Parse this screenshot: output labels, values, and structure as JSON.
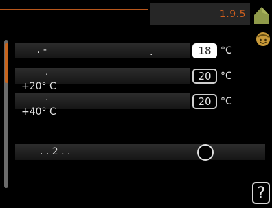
{
  "header": {
    "menu_number": "1.9.5"
  },
  "rows": [
    {
      "label_dots": ".   -",
      "label_dot_2": ".",
      "value": "18",
      "unit": "°C",
      "selected": true
    },
    {
      "label_dot": ".",
      "label": "+20° C",
      "value": "20",
      "unit": "°C",
      "selected": false
    },
    {
      "label_dot": ".",
      "label": "+40° C",
      "value": "20",
      "unit": "°C",
      "selected": false
    },
    {
      "label": ".  . 2   .    .",
      "toggle_on": false
    }
  ],
  "help": {
    "label": "?"
  },
  "colors": {
    "accent": "#d05f1e",
    "home_icon": "#8f9a4a",
    "smile_icon": "#c89a3a"
  },
  "icons": [
    "home-icon",
    "smile-icon"
  ]
}
